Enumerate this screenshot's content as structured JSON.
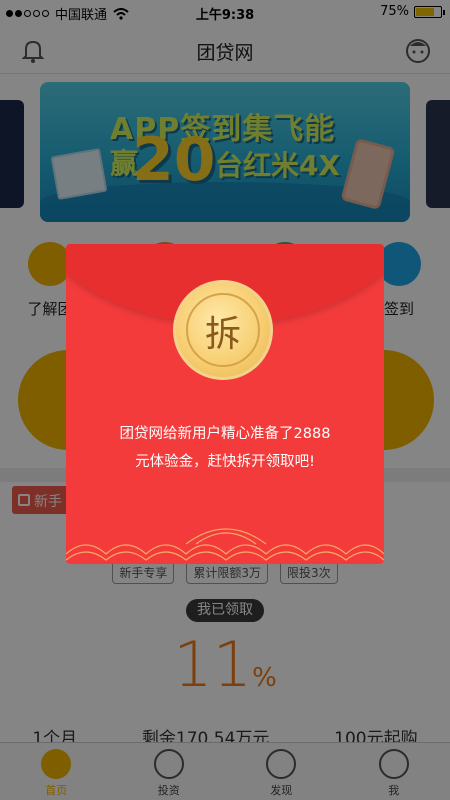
{
  "status_bar": {
    "carrier": "中国联通",
    "time": "上午9:38",
    "battery": "75%",
    "battery_level": 0.75
  },
  "nav": {
    "title": "团贷网",
    "left_icon": "bell-icon",
    "right_icon": "avatar-icon"
  },
  "quick_menu": {
    "items": [
      {
        "label": "了解团",
        "icon": "pi-coin-icon"
      },
      {
        "label": "",
        "icon": "gift-icon"
      },
      {
        "label": "",
        "icon": "chart-icon"
      },
      {
        "label": "签到",
        "icon": "pen-icon"
      }
    ]
  },
  "section": {
    "newbie_label": "新手"
  },
  "product": {
    "tags": [
      "新手专享",
      "累计限额3万",
      "限投3次"
    ],
    "claimed_label": "我已领取",
    "rate_value": "11",
    "rate_unit": "%",
    "stats": [
      "1个月",
      "剩余170.54万元",
      "100元起购"
    ]
  },
  "modal": {
    "seal_char": "拆",
    "message_line1": "团贷网给新用户精心准备了2888",
    "message_line2": "元体验金，赶快拆开领取吧!"
  },
  "tabbar": {
    "tabs": [
      {
        "label": "首页",
        "icon": "pi-home-icon",
        "active": true
      },
      {
        "label": "投资",
        "icon": "invest-chart-icon",
        "active": false
      },
      {
        "label": "发现",
        "icon": "compass-icon",
        "active": false
      },
      {
        "label": "我",
        "icon": "user-icon",
        "active": false
      }
    ]
  },
  "colors": {
    "envelope_red": "#f33b3b",
    "accent_orange": "#ee7a1a",
    "tab_active": "#f4b400"
  }
}
